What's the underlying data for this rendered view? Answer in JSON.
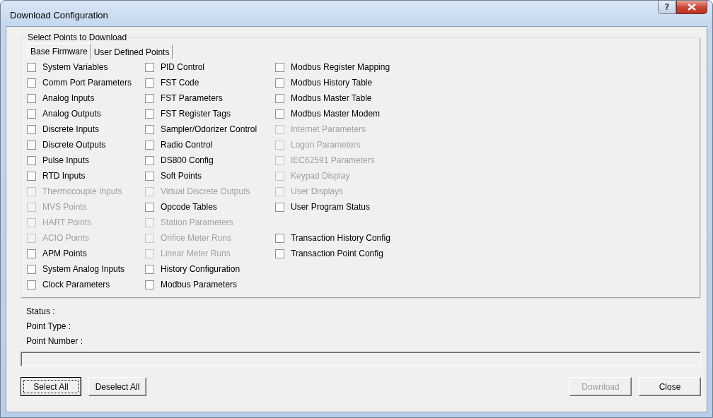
{
  "window": {
    "title": "Download Configuration",
    "help_label": "?"
  },
  "group": {
    "title": "Select Points to Download",
    "tabs": [
      {
        "label": "Base Firmware",
        "selected": true
      },
      {
        "label": "User Defined Points",
        "selected": false
      }
    ],
    "columns": [
      {
        "groups": [
          [
            {
              "label": "System Variables",
              "checked": false,
              "disabled": false
            },
            {
              "label": "Comm Port Parameters",
              "checked": false,
              "disabled": false
            },
            {
              "label": "Analog Inputs",
              "checked": false,
              "disabled": false
            },
            {
              "label": "Analog Outputs",
              "checked": false,
              "disabled": false
            },
            {
              "label": "Discrete Inputs",
              "checked": false,
              "disabled": false
            },
            {
              "label": "Discrete Outputs",
              "checked": false,
              "disabled": false
            },
            {
              "label": "Pulse Inputs",
              "checked": false,
              "disabled": false
            },
            {
              "label": "RTD Inputs",
              "checked": false,
              "disabled": false
            },
            {
              "label": "Thermocouple Inputs",
              "checked": false,
              "disabled": true
            },
            {
              "label": "MVS Points",
              "checked": false,
              "disabled": true
            },
            {
              "label": "HART Points",
              "checked": false,
              "disabled": true
            },
            {
              "label": "ACIO Points",
              "checked": false,
              "disabled": true
            },
            {
              "label": "APM Points",
              "checked": false,
              "disabled": false
            },
            {
              "label": "System Analog Inputs",
              "checked": false,
              "disabled": false
            },
            {
              "label": "Clock Parameters",
              "checked": false,
              "disabled": false
            }
          ]
        ]
      },
      {
        "groups": [
          [
            {
              "label": "PID Control",
              "checked": false,
              "disabled": false
            },
            {
              "label": "FST Code",
              "checked": false,
              "disabled": false
            },
            {
              "label": "FST Parameters",
              "checked": false,
              "disabled": false
            },
            {
              "label": "FST Register Tags",
              "checked": false,
              "disabled": false
            },
            {
              "label": "Sampler/Odorizer Control",
              "checked": false,
              "disabled": false
            },
            {
              "label": "Radio Control",
              "checked": false,
              "disabled": false
            },
            {
              "label": "DS800 Config",
              "checked": false,
              "disabled": false
            },
            {
              "label": "Soft Points",
              "checked": false,
              "disabled": false
            },
            {
              "label": "Virtual Discrete Outputs",
              "checked": false,
              "disabled": true
            },
            {
              "label": "Opcode Tables",
              "checked": false,
              "disabled": false
            },
            {
              "label": "Station Parameters",
              "checked": false,
              "disabled": true
            },
            {
              "label": "Orifice Meter Runs",
              "checked": false,
              "disabled": true
            },
            {
              "label": "Linear Meter Runs",
              "checked": false,
              "disabled": true
            },
            {
              "label": "History Configuration",
              "checked": false,
              "disabled": false
            },
            {
              "label": "Modbus Parameters",
              "checked": false,
              "disabled": false
            }
          ]
        ]
      },
      {
        "groups": [
          [
            {
              "label": "Modbus Register Mapping",
              "checked": false,
              "disabled": false
            },
            {
              "label": "Modbus History Table",
              "checked": false,
              "disabled": false
            },
            {
              "label": "Modbus Master Table",
              "checked": false,
              "disabled": false
            },
            {
              "label": "Modbus Master Modem",
              "checked": false,
              "disabled": false
            },
            {
              "label": "Internet Parameters",
              "checked": false,
              "disabled": true
            },
            {
              "label": "Logon Parameters",
              "checked": false,
              "disabled": true
            },
            {
              "label": "IEC62591 Parameters",
              "checked": false,
              "disabled": true
            },
            {
              "label": "Keypad Display",
              "checked": false,
              "disabled": true
            },
            {
              "label": "User Displays",
              "checked": false,
              "disabled": true
            },
            {
              "label": "User Program Status",
              "checked": false,
              "disabled": false
            }
          ],
          [
            {
              "label": "Transaction History Config",
              "checked": false,
              "disabled": false
            },
            {
              "label": "Transaction Point Config",
              "checked": false,
              "disabled": false
            }
          ]
        ]
      }
    ]
  },
  "status_lines": [
    "Status :",
    "Point Type :",
    "Point Number :"
  ],
  "progress": {
    "level": 0
  },
  "left_buttons": [
    {
      "label": "Select All",
      "focused": true,
      "disabled": false
    },
    {
      "label": "Deselect All",
      "focused": false,
      "disabled": false
    }
  ],
  "right_buttons": [
    {
      "label": "Download",
      "focused": false,
      "disabled": true
    },
    {
      "label": "Close",
      "focused": false,
      "disabled": false
    }
  ]
}
